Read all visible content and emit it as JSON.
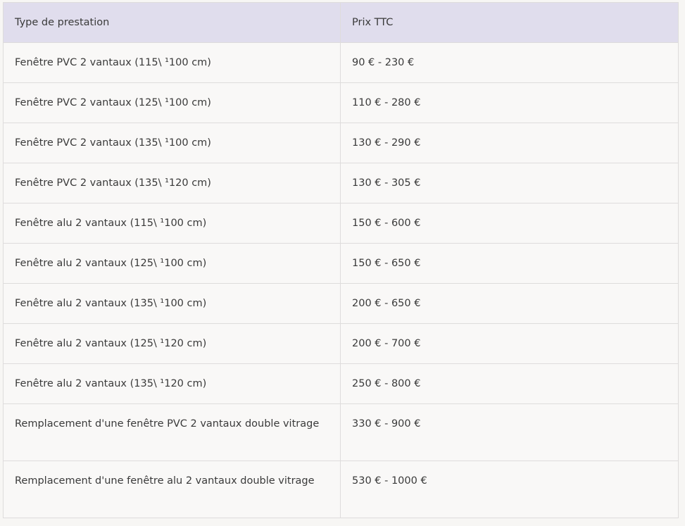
{
  "table": {
    "headers": [
      "Type de prestation",
      "Prix TTC"
    ],
    "rows": [
      {
        "type": "Fenêtre PVC 2 vantaux (115\\ ¹100 cm)",
        "price": "90 € - 230 €"
      },
      {
        "type": "Fenêtre PVC 2 vantaux (125\\ ¹100 cm)",
        "price": "110 € - 280 €"
      },
      {
        "type": "Fenêtre PVC 2 vantaux (135\\ ¹100 cm)",
        "price": "130 € - 290 €"
      },
      {
        "type": "Fenêtre PVC 2 vantaux (135\\ ¹120 cm)",
        "price": "130 € - 305 €"
      },
      {
        "type": "Fenêtre alu 2 vantaux (115\\ ¹100 cm)",
        "price": "150 € - 600 €"
      },
      {
        "type": "Fenêtre alu 2 vantaux (125\\ ¹100 cm)",
        "price": "150 € - 650 €"
      },
      {
        "type": "Fenêtre alu 2 vantaux (135\\ ¹100 cm)",
        "price": "200 € - 650 €"
      },
      {
        "type": "Fenêtre alu 2 vantaux (125\\ ¹120 cm)",
        "price": "200 € - 700 €"
      },
      {
        "type": "Fenêtre alu 2 vantaux (135\\ ¹120 cm)",
        "price": "250 € - 800 €"
      },
      {
        "type": "Remplacement d'une fenêtre PVC 2 vantaux double vitrage",
        "price": "330 € - 900 €"
      },
      {
        "type": "Remplacement d'une fenêtre alu 2 vantaux double vitrage",
        "price": "530 € - 1000 €"
      }
    ]
  },
  "colors": {
    "header_bg": "#e0dded",
    "row_bg": "#f9f8f7",
    "border": "#dedcdc",
    "text": "#3a3a3a"
  }
}
